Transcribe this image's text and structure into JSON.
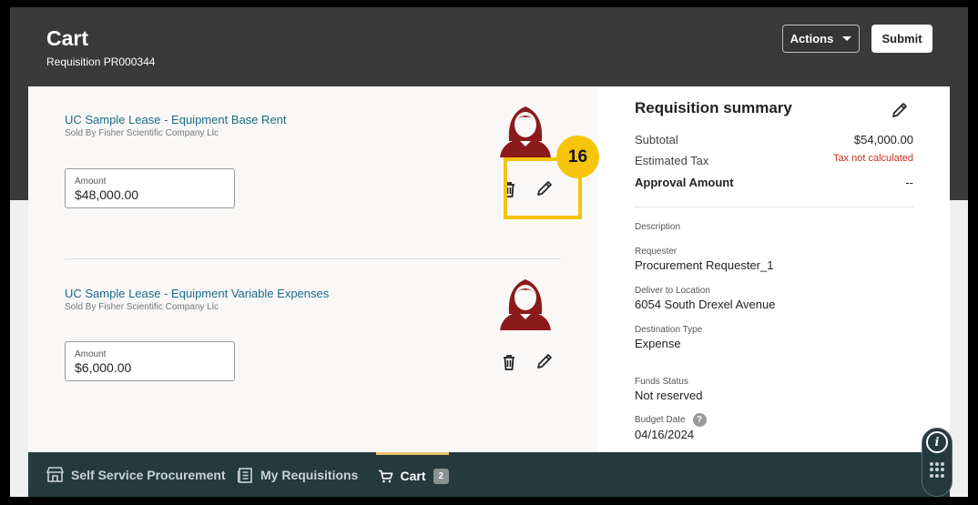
{
  "header": {
    "title": "Cart",
    "subtitle": "Requisition PR000344",
    "actions_label": "Actions",
    "submit_label": "Submit"
  },
  "lines": [
    {
      "title": "UC Sample Lease - Equipment Base Rent",
      "seller": "Sold By Fisher Scientific Company Llc",
      "amount_label": "Amount",
      "amount_value": "$48,000.00"
    },
    {
      "title": "UC Sample Lease - Equipment Variable Expenses",
      "seller": "Sold By Fisher Scientific Company Llc",
      "amount_label": "Amount",
      "amount_value": "$6,000.00"
    }
  ],
  "callout": {
    "step": "16"
  },
  "summary": {
    "title": "Requisition summary",
    "subtotal_label": "Subtotal",
    "subtotal_value": "$54,000.00",
    "tax_label": "Estimated Tax",
    "tax_value": "Tax not calculated",
    "approval_label": "Approval Amount",
    "approval_value": "--",
    "description_label": "Description",
    "requester_label": "Requester",
    "requester_value": "Procurement Requester_1",
    "deliver_label": "Deliver to Location",
    "deliver_value": "6054 South Drexel Avenue",
    "destination_label": "Destination Type",
    "destination_value": "Expense",
    "funds_label": "Funds Status",
    "funds_value": "Not reserved",
    "budget_label": "Budget Date",
    "budget_value": "04/16/2024",
    "help_glyph": "?"
  },
  "nav": {
    "self_service": "Self Service Procurement",
    "my_requisitions": "My Requisitions",
    "cart": "Cart",
    "cart_count": "2"
  },
  "fab": {
    "info_glyph": "i"
  },
  "colors": {
    "header_bg": "#3a3a3a",
    "link": "#1a6a8a",
    "avatar": "#8b1a1a",
    "highlight": "#f6c40a",
    "tax_red": "#c0311e",
    "nav_bg": "#253a3c",
    "nav_active": "#e8c36a"
  }
}
